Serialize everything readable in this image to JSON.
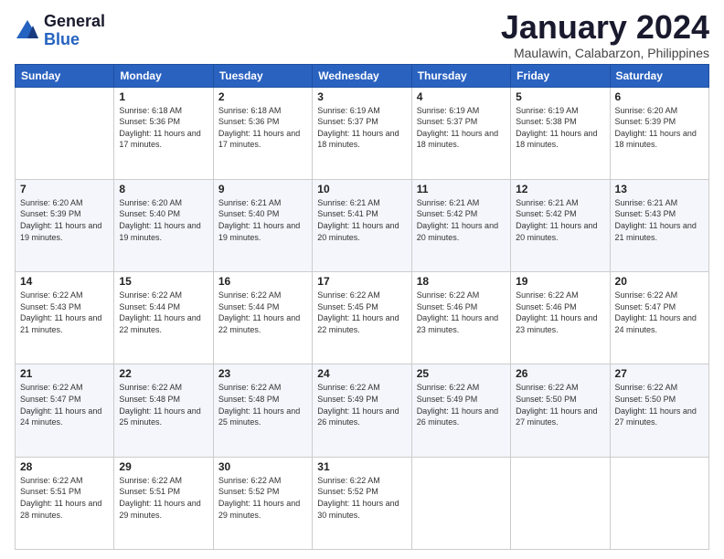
{
  "header": {
    "logo_general": "General",
    "logo_blue": "Blue",
    "month_title": "January 2024",
    "subtitle": "Maulawin, Calabarzon, Philippines"
  },
  "weekdays": [
    "Sunday",
    "Monday",
    "Tuesday",
    "Wednesday",
    "Thursday",
    "Friday",
    "Saturday"
  ],
  "weeks": [
    [
      {
        "day": "",
        "sunrise": "",
        "sunset": "",
        "daylight": ""
      },
      {
        "day": "1",
        "sunrise": "6:18 AM",
        "sunset": "5:36 PM",
        "daylight": "11 hours and 17 minutes."
      },
      {
        "day": "2",
        "sunrise": "6:18 AM",
        "sunset": "5:36 PM",
        "daylight": "11 hours and 17 minutes."
      },
      {
        "day": "3",
        "sunrise": "6:19 AM",
        "sunset": "5:37 PM",
        "daylight": "11 hours and 18 minutes."
      },
      {
        "day": "4",
        "sunrise": "6:19 AM",
        "sunset": "5:37 PM",
        "daylight": "11 hours and 18 minutes."
      },
      {
        "day": "5",
        "sunrise": "6:19 AM",
        "sunset": "5:38 PM",
        "daylight": "11 hours and 18 minutes."
      },
      {
        "day": "6",
        "sunrise": "6:20 AM",
        "sunset": "5:39 PM",
        "daylight": "11 hours and 18 minutes."
      }
    ],
    [
      {
        "day": "7",
        "sunrise": "6:20 AM",
        "sunset": "5:39 PM",
        "daylight": "11 hours and 19 minutes."
      },
      {
        "day": "8",
        "sunrise": "6:20 AM",
        "sunset": "5:40 PM",
        "daylight": "11 hours and 19 minutes."
      },
      {
        "day": "9",
        "sunrise": "6:21 AM",
        "sunset": "5:40 PM",
        "daylight": "11 hours and 19 minutes."
      },
      {
        "day": "10",
        "sunrise": "6:21 AM",
        "sunset": "5:41 PM",
        "daylight": "11 hours and 20 minutes."
      },
      {
        "day": "11",
        "sunrise": "6:21 AM",
        "sunset": "5:42 PM",
        "daylight": "11 hours and 20 minutes."
      },
      {
        "day": "12",
        "sunrise": "6:21 AM",
        "sunset": "5:42 PM",
        "daylight": "11 hours and 20 minutes."
      },
      {
        "day": "13",
        "sunrise": "6:21 AM",
        "sunset": "5:43 PM",
        "daylight": "11 hours and 21 minutes."
      }
    ],
    [
      {
        "day": "14",
        "sunrise": "6:22 AM",
        "sunset": "5:43 PM",
        "daylight": "11 hours and 21 minutes."
      },
      {
        "day": "15",
        "sunrise": "6:22 AM",
        "sunset": "5:44 PM",
        "daylight": "11 hours and 22 minutes."
      },
      {
        "day": "16",
        "sunrise": "6:22 AM",
        "sunset": "5:44 PM",
        "daylight": "11 hours and 22 minutes."
      },
      {
        "day": "17",
        "sunrise": "6:22 AM",
        "sunset": "5:45 PM",
        "daylight": "11 hours and 22 minutes."
      },
      {
        "day": "18",
        "sunrise": "6:22 AM",
        "sunset": "5:46 PM",
        "daylight": "11 hours and 23 minutes."
      },
      {
        "day": "19",
        "sunrise": "6:22 AM",
        "sunset": "5:46 PM",
        "daylight": "11 hours and 23 minutes."
      },
      {
        "day": "20",
        "sunrise": "6:22 AM",
        "sunset": "5:47 PM",
        "daylight": "11 hours and 24 minutes."
      }
    ],
    [
      {
        "day": "21",
        "sunrise": "6:22 AM",
        "sunset": "5:47 PM",
        "daylight": "11 hours and 24 minutes."
      },
      {
        "day": "22",
        "sunrise": "6:22 AM",
        "sunset": "5:48 PM",
        "daylight": "11 hours and 25 minutes."
      },
      {
        "day": "23",
        "sunrise": "6:22 AM",
        "sunset": "5:48 PM",
        "daylight": "11 hours and 25 minutes."
      },
      {
        "day": "24",
        "sunrise": "6:22 AM",
        "sunset": "5:49 PM",
        "daylight": "11 hours and 26 minutes."
      },
      {
        "day": "25",
        "sunrise": "6:22 AM",
        "sunset": "5:49 PM",
        "daylight": "11 hours and 26 minutes."
      },
      {
        "day": "26",
        "sunrise": "6:22 AM",
        "sunset": "5:50 PM",
        "daylight": "11 hours and 27 minutes."
      },
      {
        "day": "27",
        "sunrise": "6:22 AM",
        "sunset": "5:50 PM",
        "daylight": "11 hours and 27 minutes."
      }
    ],
    [
      {
        "day": "28",
        "sunrise": "6:22 AM",
        "sunset": "5:51 PM",
        "daylight": "11 hours and 28 minutes."
      },
      {
        "day": "29",
        "sunrise": "6:22 AM",
        "sunset": "5:51 PM",
        "daylight": "11 hours and 29 minutes."
      },
      {
        "day": "30",
        "sunrise": "6:22 AM",
        "sunset": "5:52 PM",
        "daylight": "11 hours and 29 minutes."
      },
      {
        "day": "31",
        "sunrise": "6:22 AM",
        "sunset": "5:52 PM",
        "daylight": "11 hours and 30 minutes."
      },
      {
        "day": "",
        "sunrise": "",
        "sunset": "",
        "daylight": ""
      },
      {
        "day": "",
        "sunrise": "",
        "sunset": "",
        "daylight": ""
      },
      {
        "day": "",
        "sunrise": "",
        "sunset": "",
        "daylight": ""
      }
    ]
  ]
}
